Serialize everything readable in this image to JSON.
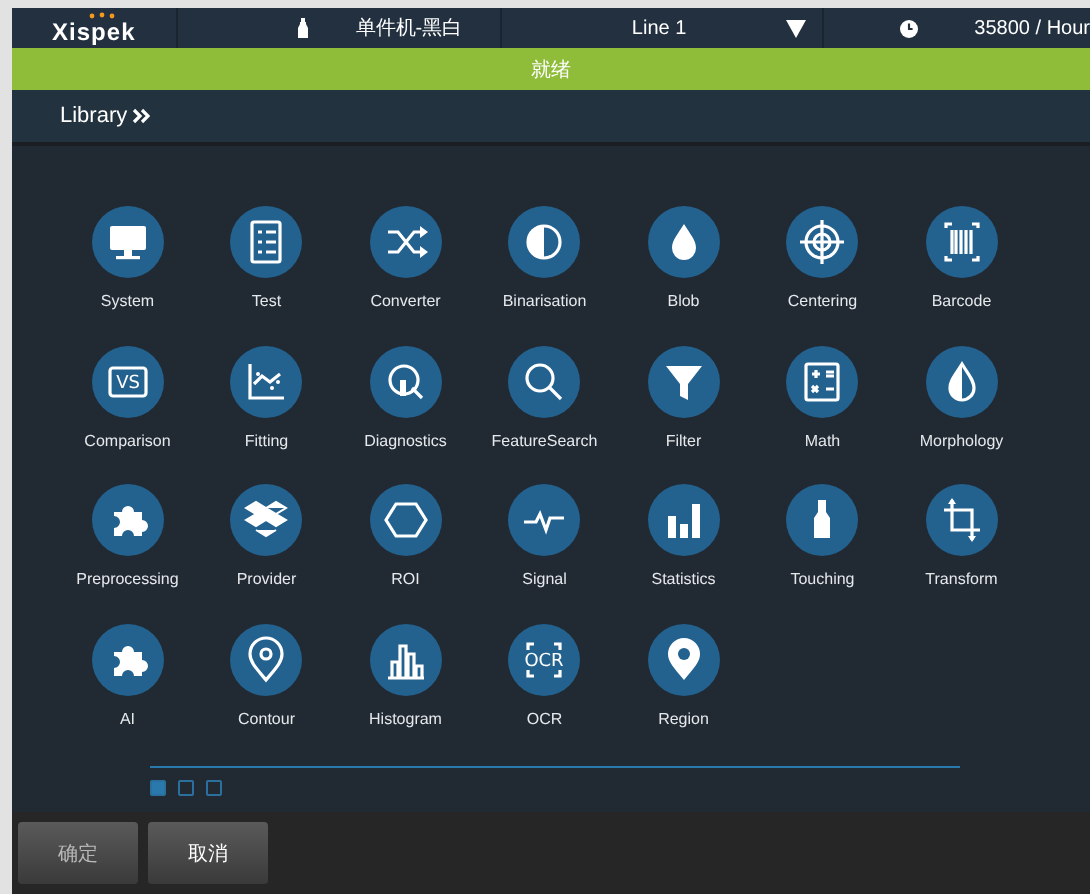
{
  "header": {
    "logo": "Xispek",
    "product": "单件机-黑白",
    "line": "Line 1",
    "rate": "35800 / Hour"
  },
  "status": "就绪",
  "section": {
    "title": "Library"
  },
  "tiles": [
    {
      "label": "System"
    },
    {
      "label": "Test"
    },
    {
      "label": "Converter"
    },
    {
      "label": "Binarisation"
    },
    {
      "label": "Blob"
    },
    {
      "label": "Centering"
    },
    {
      "label": "Barcode"
    },
    {
      "label": "Comparison",
      "icon_text": "VS"
    },
    {
      "label": "Fitting"
    },
    {
      "label": "Diagnostics"
    },
    {
      "label": "FeatureSearch"
    },
    {
      "label": "Filter"
    },
    {
      "label": "Math"
    },
    {
      "label": "Morphology"
    },
    {
      "label": "Preprocessing"
    },
    {
      "label": "Provider"
    },
    {
      "label": "ROI"
    },
    {
      "label": "Signal"
    },
    {
      "label": "Statistics"
    },
    {
      "label": "Touching"
    },
    {
      "label": "Transform"
    },
    {
      "label": "AI"
    },
    {
      "label": "Contour"
    },
    {
      "label": "Histogram"
    },
    {
      "label": "OCR",
      "icon_text": "OCR"
    },
    {
      "label": "Region"
    }
  ],
  "pages": [
    {
      "selected": true
    },
    {
      "selected": false
    },
    {
      "selected": false
    }
  ],
  "buttons": [
    {
      "label": "确定",
      "disabled": true
    },
    {
      "label": "取消",
      "disabled": false
    }
  ]
}
